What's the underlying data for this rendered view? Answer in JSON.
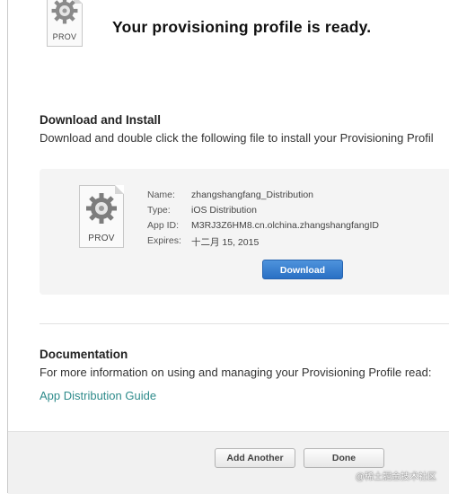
{
  "header": {
    "file_icon_label": "PROV",
    "title": "Your provisioning profile is ready."
  },
  "download_section": {
    "heading": "Download and Install",
    "description": "Download and double click the following file to install your Provisioning Profil",
    "file": {
      "icon_label": "PROV",
      "fields": [
        {
          "key": "Name:",
          "value": "zhangshangfang_Distribution"
        },
        {
          "key": "Type:",
          "value": "iOS Distribution"
        },
        {
          "key": "App ID:",
          "value": "M3RJ3Z6HM8.cn.olchina.zhangshangfangID"
        },
        {
          "key": "Expires:",
          "value": "十二月 15, 2015"
        }
      ],
      "download_label": "Download"
    }
  },
  "documentation_section": {
    "heading": "Documentation",
    "description": "For more information on using and managing your Provisioning Profile read:",
    "link_label": "App Distribution Guide"
  },
  "footer": {
    "add_another_label": "Add Another",
    "done_label": "Done"
  },
  "watermark": "@稀土掘金技术社区",
  "colors": {
    "link": "#2e8b8b",
    "primary_button": "#2f76c8"
  }
}
